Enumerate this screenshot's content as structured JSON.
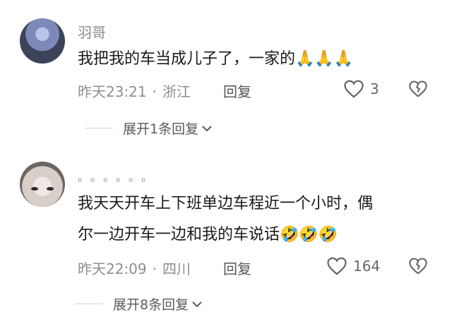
{
  "comments": [
    {
      "username": "羽哥",
      "content": "我把我的车当成儿子了，一家的",
      "emoji": "🙏🙏🙏",
      "time": "昨天23:21",
      "separator": "·",
      "location": "浙江",
      "reply_label": "回复",
      "like_count": "3",
      "expand_label": "展开1条回复"
    },
    {
      "username": "。。。。。。",
      "content_line1": "我天天开车上下班单边车程近一个小时，偶",
      "content_line2": "尔一边开车一边和我的车说话",
      "emoji": "🤣🤣🤣",
      "time": "昨天22:09",
      "separator": "·",
      "location": "四川",
      "reply_label": "回复",
      "like_count": "164",
      "expand_label": "展开8条回复"
    }
  ],
  "icons": {
    "heart": "heart-icon",
    "broken_heart": "broken-heart-icon",
    "chevron": "chevron-down-icon"
  }
}
